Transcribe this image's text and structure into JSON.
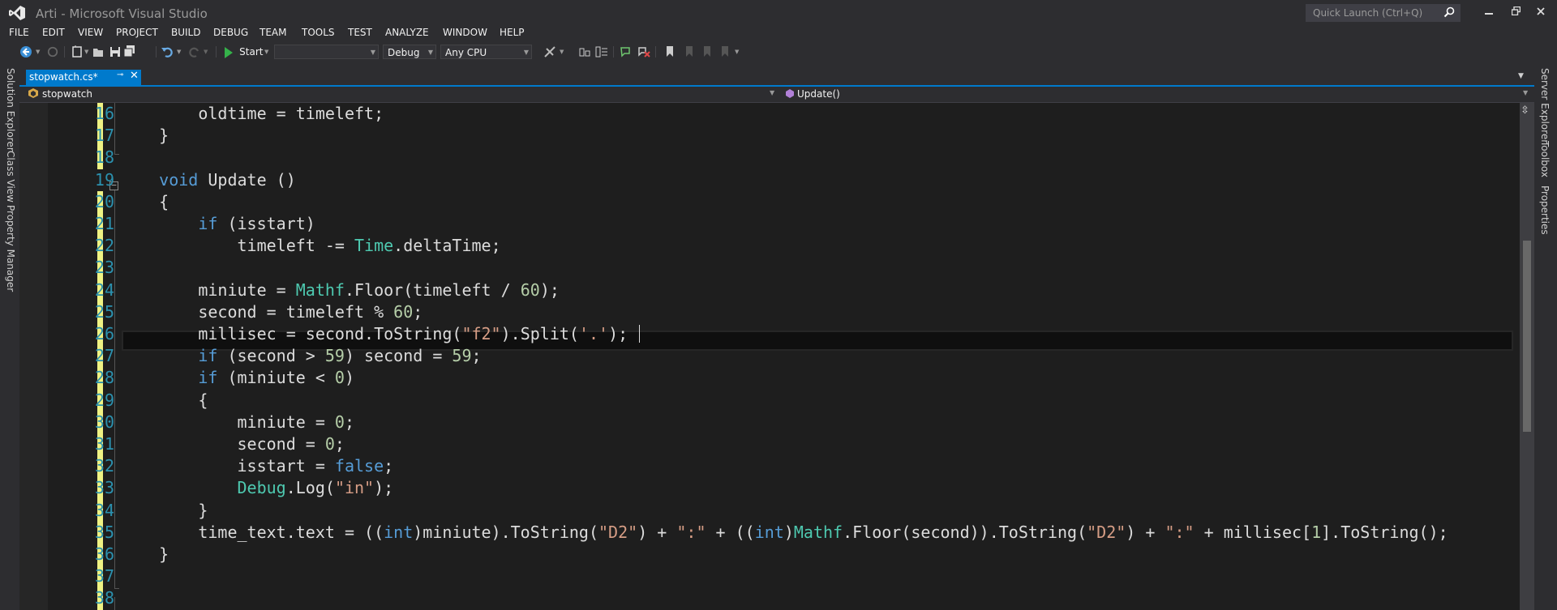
{
  "window": {
    "title": "Arti - Microsoft Visual Studio",
    "quick_launch_placeholder": "Quick Launch (Ctrl+Q)",
    "controls": [
      "minimize",
      "restore",
      "close"
    ]
  },
  "menu": [
    "FILE",
    "EDIT",
    "VIEW",
    "PROJECT",
    "BUILD",
    "DEBUG",
    "TEAM",
    "TOOLS",
    "TEST",
    "ANALYZE",
    "WINDOW",
    "HELP"
  ],
  "toolbar": {
    "start_label": "Start",
    "configuration": "Debug",
    "platform": "Any CPU",
    "target": ""
  },
  "left_tools": [
    "Solution Explorer",
    "Class View",
    "Property Manager"
  ],
  "right_tools": [
    "Server Explorer",
    "Toolbox",
    "Properties"
  ],
  "tabs": [
    {
      "label": "stopwatch.cs*",
      "active": true
    }
  ],
  "navbar": {
    "type_label": "stopwatch",
    "member_label": "Update()"
  },
  "editor": {
    "current_line": 26,
    "line_numbers": [
      "16",
      "17",
      "18",
      "19",
      "20",
      "21",
      "22",
      "23",
      "24",
      "25",
      "26",
      "27",
      "28",
      "29",
      "30",
      "31",
      "32",
      "33",
      "34",
      "35",
      "36",
      "37",
      "38"
    ],
    "lines": [
      {
        "num": "16",
        "text": "        oldtime = timeleft;"
      },
      {
        "num": "17",
        "text": "    }"
      },
      {
        "num": "18",
        "text": ""
      },
      {
        "num": "19",
        "text": "    void Update ()"
      },
      {
        "num": "20",
        "text": "    {"
      },
      {
        "num": "21",
        "text": "        if (isstart)"
      },
      {
        "num": "22",
        "text": "            timeleft -= Time.deltaTime;"
      },
      {
        "num": "23",
        "text": ""
      },
      {
        "num": "24",
        "text": "        miniute = Mathf.Floor(timeleft / 60);"
      },
      {
        "num": "25",
        "text": "        second = timeleft % 60;"
      },
      {
        "num": "26",
        "text": "        millisec = second.ToString(\"f2\").Split('.');"
      },
      {
        "num": "27",
        "text": "        if (second > 59) second = 59;"
      },
      {
        "num": "28",
        "text": "        if (miniute < 0)"
      },
      {
        "num": "29",
        "text": "        {"
      },
      {
        "num": "30",
        "text": "            miniute = 0;"
      },
      {
        "num": "31",
        "text": "            second = 0;"
      },
      {
        "num": "32",
        "text": "            isstart = false;"
      },
      {
        "num": "33",
        "text": "            Debug.Log(\"in\");"
      },
      {
        "num": "34",
        "text": "        }"
      },
      {
        "num": "35",
        "text": "        time_text.text = ((int)miniute).ToString(\"D2\") + \":\" + ((int)Mathf.Floor(second)).ToString(\"D2\") + \":\" + millisec[1].ToString();"
      },
      {
        "num": "36",
        "text": "    }"
      },
      {
        "num": "37",
        "text": ""
      },
      {
        "num": "38",
        "text": ""
      }
    ]
  },
  "colors": {
    "accent": "#007acc",
    "editor_bg": "#1e1e1e",
    "chrome_bg": "#2d2d30",
    "line_number": "#2b91af",
    "keyword": "#569cd6",
    "type": "#4ec9b0",
    "string": "#d69d85",
    "number": "#b5cea8",
    "change_marker": "#eff284"
  }
}
